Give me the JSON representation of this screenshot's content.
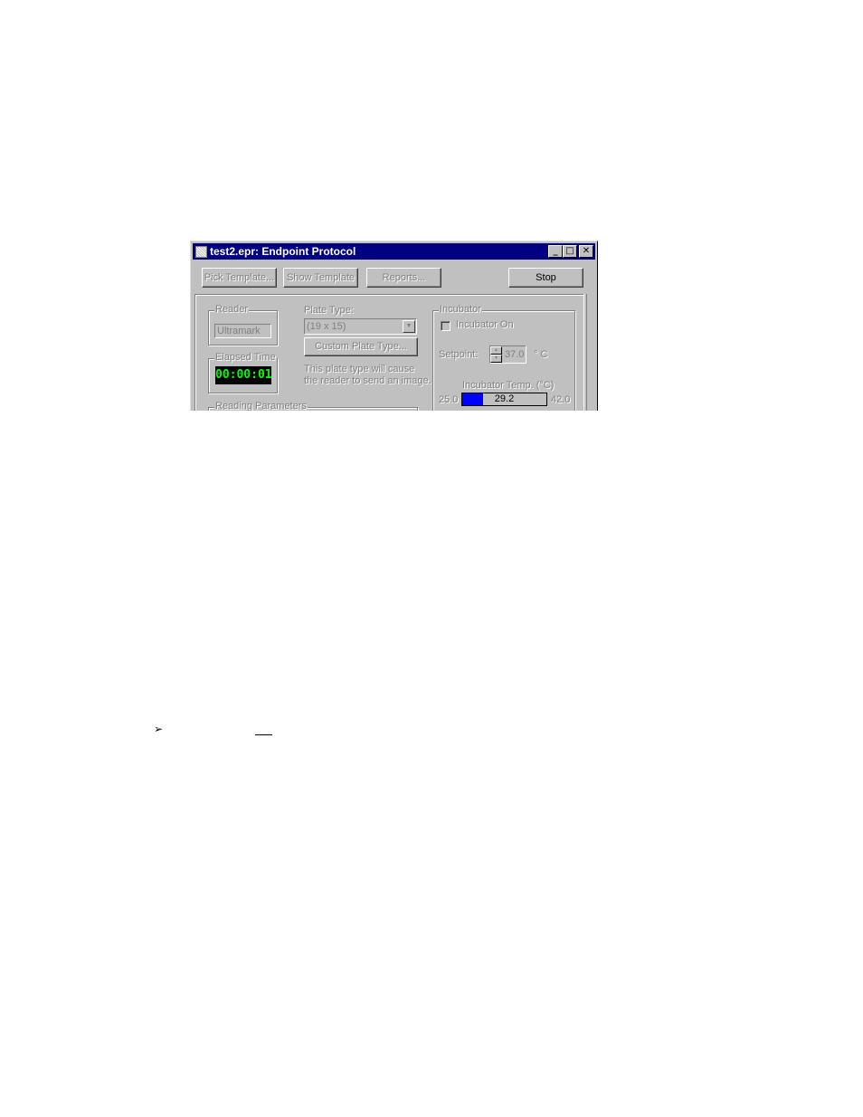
{
  "window": {
    "title": "test2.epr: Endpoint Protocol",
    "caption_buttons": {
      "minimize": "_",
      "maximize": "□",
      "close": "✕"
    }
  },
  "toolbar": {
    "pick_template": "Pick Template...",
    "show_template": "Show Template",
    "reports": "Reports...",
    "stop": "Stop"
  },
  "reader": {
    "group_label": "Reader",
    "value": "Ultramark"
  },
  "elapsed_time": {
    "group_label": "Elapsed Time",
    "value": "00:00:01"
  },
  "plate": {
    "label": "Plate Type:",
    "selected": "(19 x 15)",
    "custom_button": "Custom Plate Type...",
    "note_line1": "This plate type will cause",
    "note_line2": "the reader to send an image."
  },
  "reading_parameters": {
    "group_label": "Reading Parameters"
  },
  "incubator": {
    "group_label": "Incubator",
    "checkbox_label": "Incubator On",
    "checkbox_checked": false,
    "setpoint_label": "Setpoint:",
    "setpoint_value": "37.0",
    "setpoint_unit": "° C",
    "temp_label": "Incubator Temp. (°C)",
    "temp_min": "25.0",
    "temp_max": "42.0",
    "temp_value": "29.2",
    "temp_fill_fraction": 0.247
  },
  "document": {
    "bullet_icon": "arrowhead-bullet"
  }
}
